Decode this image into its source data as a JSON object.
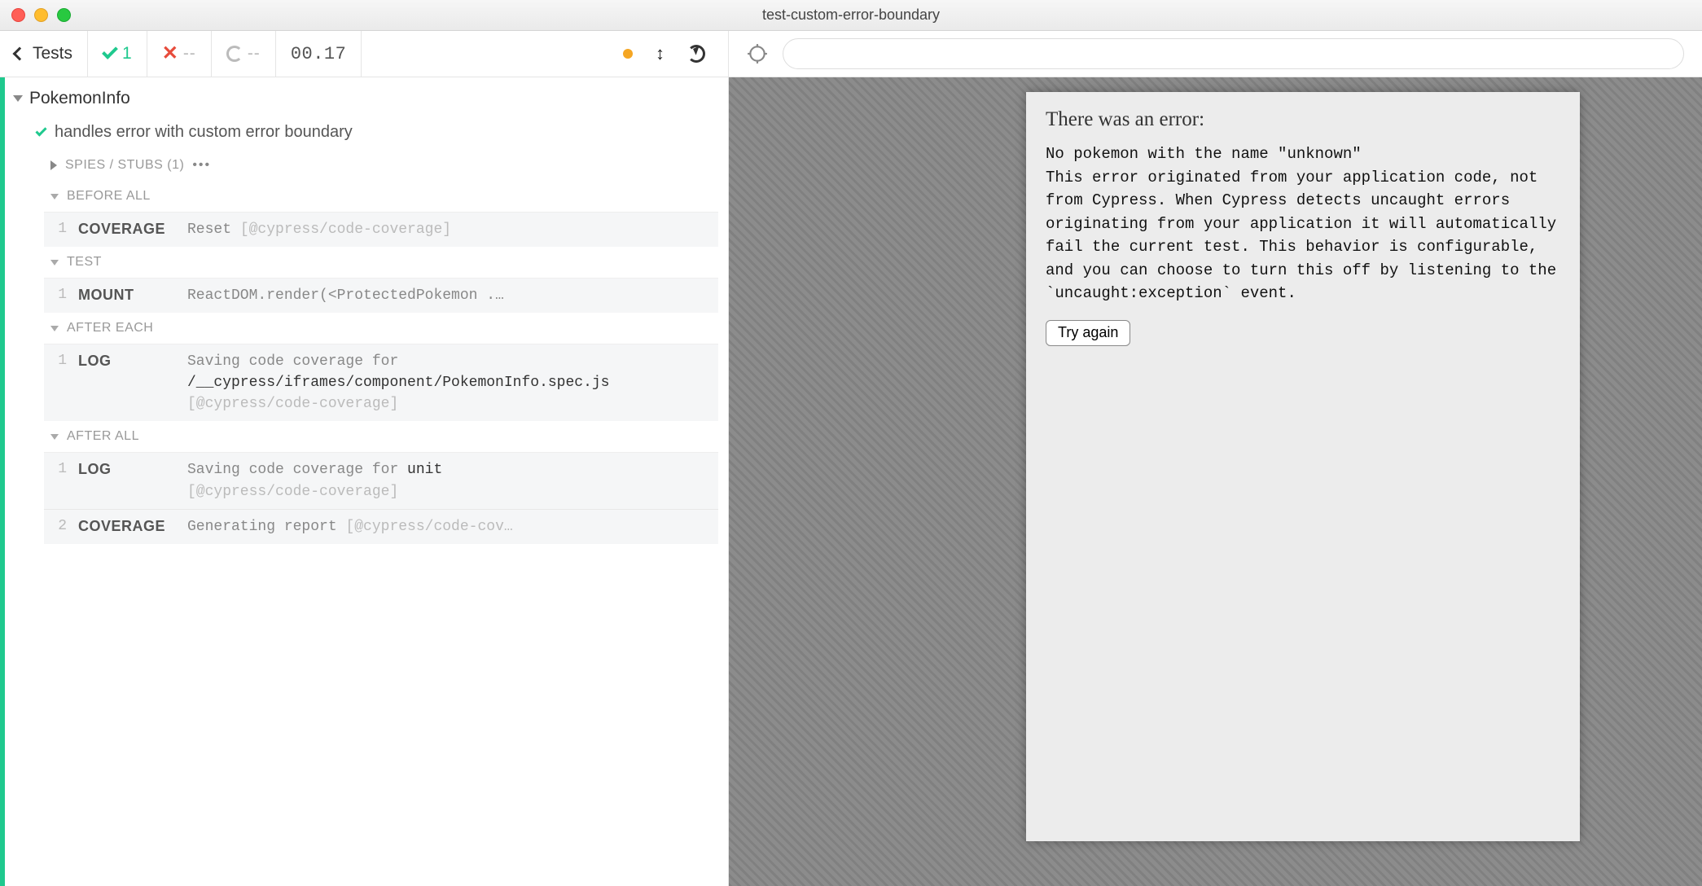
{
  "window": {
    "title": "test-custom-error-boundary"
  },
  "toolbar": {
    "back_label": "Tests",
    "pass_count": "1",
    "fail_count": "--",
    "pending_count": "--",
    "duration": "00.17"
  },
  "suite": {
    "name": "PokemonInfo",
    "test": {
      "title": "handles error with custom error boundary",
      "spies_label": "SPIES / STUBS (1)",
      "hooks": [
        {
          "name": "BEFORE ALL",
          "commands": [
            {
              "num": "1",
              "type": "COVERAGE",
              "msg_plain": "Reset ",
              "msg_faint": "[@cypress/code-coverage]"
            }
          ]
        },
        {
          "name": "TEST",
          "commands": [
            {
              "num": "1",
              "type": "MOUNT",
              "msg_plain": "ReactDOM.render(<ProtectedPokemon .…"
            }
          ]
        },
        {
          "name": "AFTER EACH",
          "commands": [
            {
              "num": "1",
              "type": "LOG",
              "msg_plain_pre": "Saving code coverage for ",
              "msg_strong": "/__cypress/iframes/component/PokemonInfo.spec.js",
              "msg_faint": " [@cypress/code-coverage]"
            }
          ]
        },
        {
          "name": "AFTER ALL",
          "commands": [
            {
              "num": "1",
              "type": "LOG",
              "msg_plain_pre": "Saving code coverage for ",
              "msg_strong": "unit",
              "msg_faint_below": "[@cypress/code-coverage]"
            },
            {
              "num": "2",
              "type": "COVERAGE",
              "msg_plain": "Generating report ",
              "msg_faint": "[@cypress/code-cov…"
            }
          ]
        }
      ]
    }
  },
  "aut": {
    "heading": "There was an error:",
    "error_text": "No pokemon with the name \"unknown\"\nThis error originated from your application code, not from Cypress. When Cypress detects uncaught errors originating from your application it will automatically fail the current test. This behavior is configurable, and you can choose to turn this off by listening to the `uncaught:exception` event.",
    "retry_label": "Try again"
  },
  "urlbar": {
    "value": ""
  }
}
